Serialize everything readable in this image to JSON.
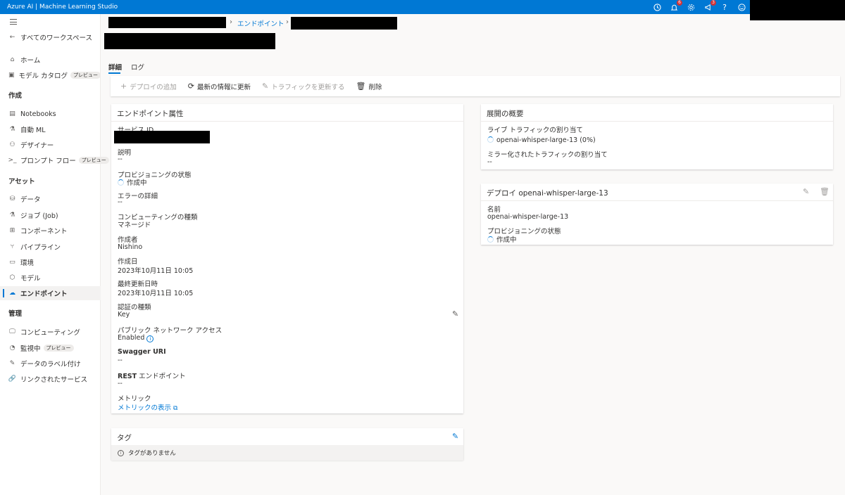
{
  "app": {
    "title": "Azure AI | Machine Learning Studio"
  },
  "topbar": {
    "icons": [
      {
        "name": "clock-icon",
        "badge": ""
      },
      {
        "name": "bell-icon",
        "badge": "6"
      },
      {
        "name": "gear-icon",
        "badge": ""
      },
      {
        "name": "megaphone-icon",
        "badge": "3"
      },
      {
        "name": "help-icon",
        "badge": ""
      },
      {
        "name": "smiley-icon",
        "badge": ""
      }
    ]
  },
  "sidebar": {
    "back": "すべてのワークスペース",
    "home": "ホーム",
    "catalog": "モデル カタログ",
    "preview": "プレビュー",
    "section_create": "作成",
    "notebooks": "Notebooks",
    "automl": "自動 ML",
    "designer": "デザイナー",
    "promptflow": "プロンプト フロー",
    "section_assets": "アセット",
    "data": "データ",
    "jobs": "ジョブ (Job)",
    "components": "コンポーネント",
    "pipelines": "パイプライン",
    "environments": "環境",
    "models": "モデル",
    "endpoints": "エンドポイント",
    "section_manage": "管理",
    "compute": "コンピューティング",
    "monitoring": "監視中",
    "labeling": "データのラベル付け",
    "linked": "リンクされたサービス"
  },
  "breadcrumb": {
    "endpoints": "エンドポイント"
  },
  "tabs": {
    "details": "詳細",
    "logs": "ログ"
  },
  "toolbar": {
    "add_deploy": "デプロイの追加",
    "refresh": "最新の情報に更新",
    "update_traffic": "トラフィックを更新する",
    "delete": "削除"
  },
  "attributes": {
    "title": "エンドポイント属性",
    "service_id": "サービス ID",
    "description_label": "説明",
    "description_value": "--",
    "provisioning_label": "プロビジョニングの状態",
    "provisioning_value": "作成中",
    "error_label": "エラーの詳細",
    "error_value": "--",
    "compute_type_label": "コンピューティングの種類",
    "compute_type_value": "マネージド",
    "creator_label": "作成者",
    "creator_value": "Nishino",
    "created_label": "作成日",
    "created_value": "2023年10月11日 10:05",
    "updated_label": "最終更新日時",
    "updated_value": "2023年10月11日 10:05",
    "auth_label": "認証の種類",
    "auth_value": "Key",
    "network_label": "パブリック ネットワーク アクセス",
    "network_value": "Enabled",
    "swagger_label": "Swagger URI",
    "swagger_value": "--",
    "rest_label": "REST エンドポイント",
    "rest_value": "--",
    "metrics_label": "メトリック",
    "metrics_link": "メトリックの表示"
  },
  "tags": {
    "title": "タグ",
    "empty": "タグがありません"
  },
  "overview": {
    "title": "展開の概要",
    "live_label": "ライブ トラフィックの割り当て",
    "live_value": "openai-whisper-large-13 (0%)",
    "mirror_label": "ミラー化されたトラフィックの割り当て",
    "mirror_value": "--"
  },
  "deployment": {
    "title": "デプロイ openai-whisper-large-13",
    "name_label": "名前",
    "name_value": "openai-whisper-large-13",
    "provisioning_label": "プロビジョニングの状態",
    "provisioning_value": "作成中"
  }
}
